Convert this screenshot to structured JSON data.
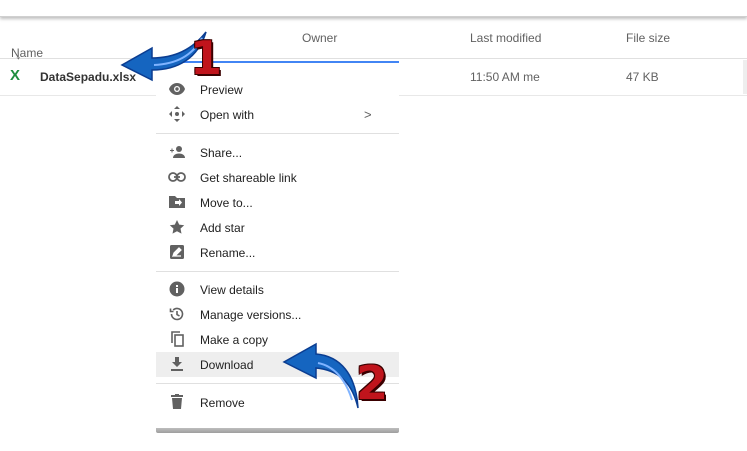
{
  "header": {
    "name": "Name",
    "owner": "Owner",
    "last_modified": "Last modified",
    "file_size": "File size"
  },
  "file": {
    "name": "DataSepadu.xlsx",
    "modified": "11:50 AM",
    "modified_by": "me",
    "size": "47 KB"
  },
  "menu": {
    "groups": [
      [
        {
          "label": "Preview",
          "icon": "eye-icon"
        },
        {
          "label": "Open with",
          "icon": "move-arrows-icon",
          "submenu": ">"
        }
      ],
      [
        {
          "label": "Share...",
          "icon": "add-person-icon"
        },
        {
          "label": "Get shareable link",
          "icon": "link-icon"
        },
        {
          "label": "Move to...",
          "icon": "folder-move-icon"
        },
        {
          "label": "Add star",
          "icon": "star-icon"
        },
        {
          "label": "Rename...",
          "icon": "rename-icon"
        }
      ],
      [
        {
          "label": "View details",
          "icon": "info-icon"
        },
        {
          "label": "Manage versions...",
          "icon": "history-icon"
        },
        {
          "label": "Make a copy",
          "icon": "copy-icon"
        },
        {
          "label": "Download",
          "icon": "download-icon"
        }
      ],
      [
        {
          "label": "Remove",
          "icon": "trash-icon"
        }
      ]
    ]
  },
  "callouts": {
    "first": "1",
    "second": "2"
  },
  "colors": {
    "accent": "#4285f4",
    "callout_arrow": "#1565c0",
    "callout_number": "#c0141c",
    "xlsx": "#1e8e3e"
  }
}
